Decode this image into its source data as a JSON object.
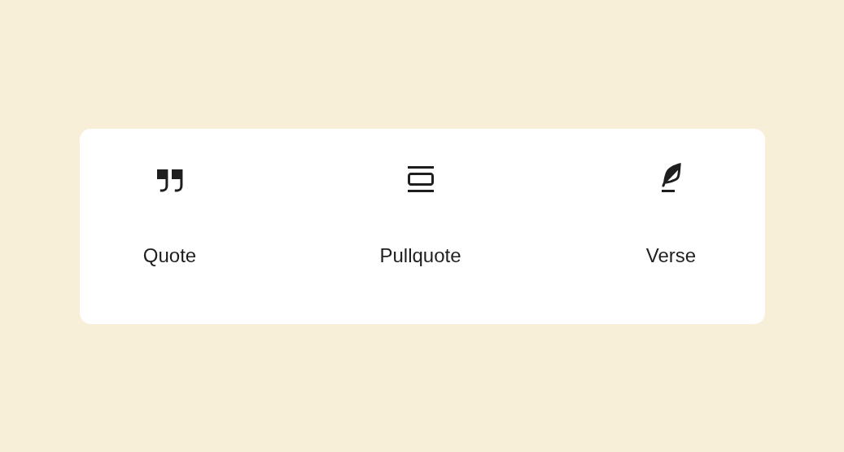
{
  "blocks": [
    {
      "kind": "quote",
      "label": "Quote"
    },
    {
      "kind": "pullquote",
      "label": "Pullquote"
    },
    {
      "kind": "verse",
      "label": "Verse"
    }
  ]
}
